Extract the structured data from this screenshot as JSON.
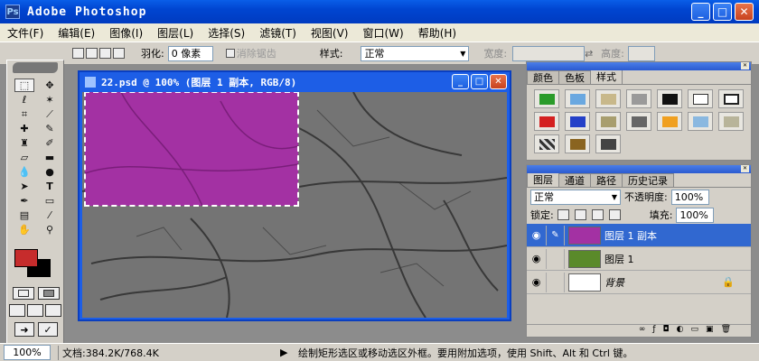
{
  "window": {
    "title": "Adobe Photoshop",
    "app_icon": "Ps",
    "minimize": "_",
    "maximize": "□",
    "close": "✕"
  },
  "menu": [
    "文件(F)",
    "编辑(E)",
    "图像(I)",
    "图层(L)",
    "选择(S)",
    "滤镜(T)",
    "视图(V)",
    "窗口(W)",
    "帮助(H)"
  ],
  "options": {
    "feather_label": "羽化:",
    "feather_value": "0 像素",
    "antialias_label": "消除锯齿",
    "style_label": "样式:",
    "style_value": "正常",
    "width_label": "宽度:",
    "height_label": "高度:"
  },
  "document": {
    "title": "22.psd @ 100% (图层 1 副本, RGB/8)"
  },
  "styles_panel": {
    "tabs": [
      "颜色",
      "色板",
      "样式"
    ]
  },
  "layers_panel": {
    "tabs": [
      "图层",
      "通道",
      "路径",
      "历史记录"
    ],
    "blend_mode": "正常",
    "opacity_label": "不透明度:",
    "opacity_value": "100%",
    "lock_label": "锁定:",
    "fill_label": "填充:",
    "fill_value": "100%",
    "layers": [
      {
        "name": "图层 1 副本",
        "selected": true
      },
      {
        "name": "图层 1",
        "selected": false
      },
      {
        "name": "背景",
        "selected": false,
        "locked": true
      }
    ]
  },
  "status": {
    "zoom": "100%",
    "doc_info": "文档:384.2K/768.4K",
    "hint": "绘制矩形选区或移动选区外框。要用附加选项，使用 Shift、Alt 和 Ctrl 键。"
  },
  "colors": {
    "foreground": "#c62c2c",
    "background": "#000000",
    "selection_fill": "#a331a3",
    "titlebar": "#0054e3"
  },
  "icons": [
    "marquee-icon",
    "move-icon",
    "lasso-icon",
    "magic-wand-icon",
    "crop-icon",
    "slice-icon",
    "healing-icon",
    "brush-icon",
    "stamp-icon",
    "history-brush-icon",
    "eraser-icon",
    "gradient-icon",
    "blur-icon",
    "dodge-icon",
    "path-select-icon",
    "type-icon",
    "pen-icon",
    "shape-icon",
    "notes-icon",
    "eyedropper-icon",
    "hand-icon",
    "zoom-icon",
    "eye-icon",
    "lock-icon"
  ]
}
